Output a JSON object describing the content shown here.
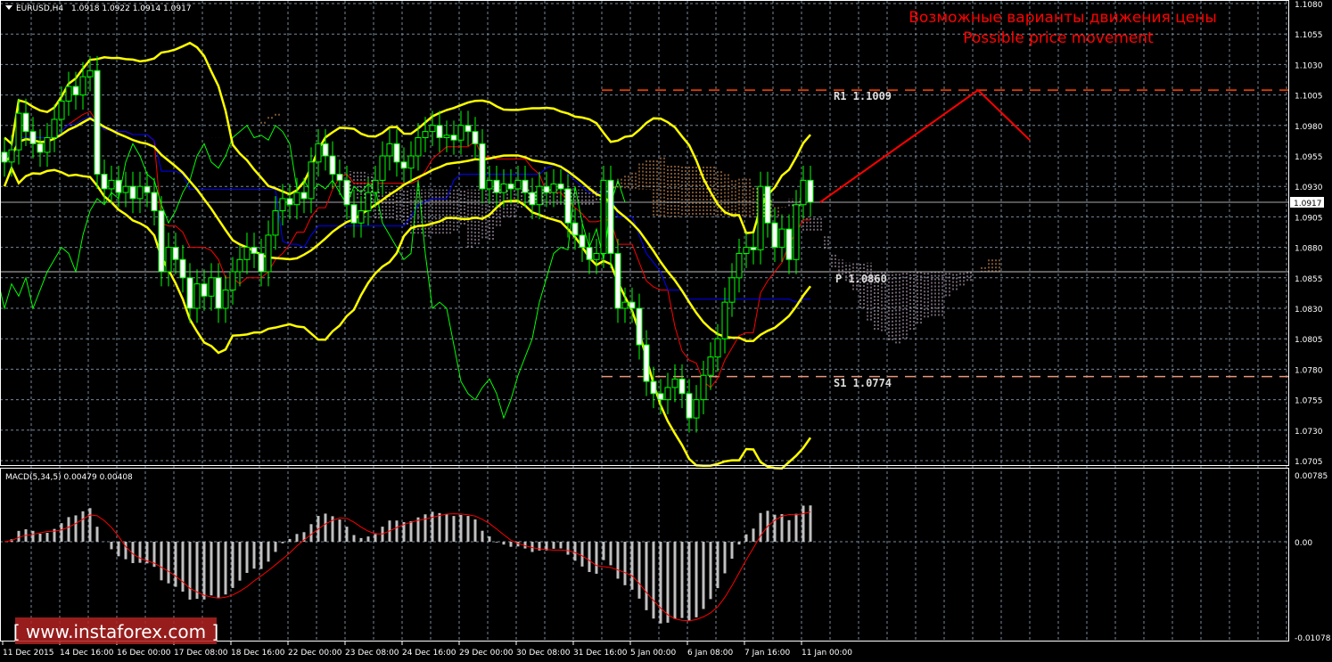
{
  "header": {
    "symbol": "EURUSD,H4",
    "ohlc": "1.0918 1.0922 1.0914 1.0917"
  },
  "annotation": {
    "line1": "Возможные варианты движения цены",
    "line2": "Possible price movement",
    "color": "#ff0000"
  },
  "levels": {
    "r1": {
      "label": "R1 1.1009",
      "price": 1.1009
    },
    "p": {
      "label": "P 1.0860",
      "price": 1.086
    },
    "s1": {
      "label": "S1 1.0774",
      "price": 1.0774
    }
  },
  "current_price": {
    "label": "1.0917",
    "price": 1.0917
  },
  "macd": {
    "label": "MACD(5,34,5) 0.00479 0.00408",
    "ticks": [
      "0.00785",
      "0.00",
      "-0.01078"
    ]
  },
  "watermark": {
    "text": "www.instaforex.com"
  },
  "colors": {
    "bollinger": "#ffff00",
    "tenkan": "#ff0000",
    "kijun": "#0000ff",
    "chikou": "#00ff00",
    "candle": "#00ff00",
    "cloud_up": "#f4a460",
    "cloud_down": "#d8bfd8",
    "grid": "#778899",
    "macd_hist": "#c0c0c0",
    "macd_signal": "#ff0000"
  },
  "chart_data": {
    "type": "candlestick",
    "ylim": [
      1.0705,
      1.108
    ],
    "price_ticks": [
      "1.1080",
      "1.1055",
      "1.1030",
      "1.1005",
      "1.0980",
      "1.0955",
      "1.0930",
      "1.0905",
      "1.0880",
      "1.0855",
      "1.0830",
      "1.0805",
      "1.0780",
      "1.0755",
      "1.0730",
      "1.0705"
    ],
    "time_labels": [
      "11 Dec 2015",
      "14 Dec 16:00",
      "16 Dec 00:00",
      "17 Dec 08:00",
      "18 Dec 16:00",
      "22 Dec 00:00",
      "23 Dec 08:00",
      "24 Dec 16:00",
      "29 Dec 00:00",
      "30 Dec 08:00",
      "31 Dec 16:00",
      "5 Jan 00:00",
      "6 Jan 08:00",
      "7 Jan 16:00",
      "11 Jan 00:00"
    ],
    "closes": [
      1.095,
      1.096,
      1.099,
      1.0975,
      1.0965,
      1.0958,
      1.097,
      1.0985,
      1.1,
      1.1012,
      1.1005,
      1.102,
      1.1025,
      1.094,
      1.0928,
      1.0935,
      1.0925,
      1.093,
      1.092,
      1.093,
      1.0925,
      1.091,
      1.086,
      1.088,
      1.087,
      1.0855,
      1.083,
      1.085,
      1.084,
      1.0855,
      1.083,
      1.0845,
      1.086,
      1.087,
      1.088,
      1.0875,
      1.086,
      1.089,
      1.091,
      1.092,
      1.0915,
      1.0925,
      1.092,
      1.095,
      1.0965,
      1.0955,
      1.094,
      1.0935,
      1.0915,
      1.09,
      1.091,
      1.0925,
      1.0935,
      1.0955,
      1.0965,
      1.095,
      1.0945,
      1.0955,
      1.097,
      1.0975,
      1.098,
      1.097,
      1.0972,
      1.0968,
      1.098,
      1.0975,
      1.0965,
      1.0928,
      1.0935,
      1.0925,
      1.0932,
      1.0928,
      1.0935,
      1.0925,
      1.0915,
      1.093,
      1.0925,
      1.0932,
      1.0928,
      1.09,
      1.089,
      1.088,
      1.087,
      1.0875,
      1.0935,
      1.0875,
      1.083,
      1.0835,
      1.083,
      1.08,
      1.077,
      1.076,
      1.0755,
      1.0765,
      1.0772,
      1.076,
      1.074,
      1.0755,
      1.0775,
      1.079,
      1.0805,
      1.0835,
      1.0855,
      1.0875,
      1.088,
      1.0878,
      1.093,
      1.09,
      1.088,
      1.0895,
      1.087,
      1.0915,
      1.0935,
      1.0917
    ],
    "projection": [
      1.0917,
      1.1009,
      1.0968
    ]
  }
}
